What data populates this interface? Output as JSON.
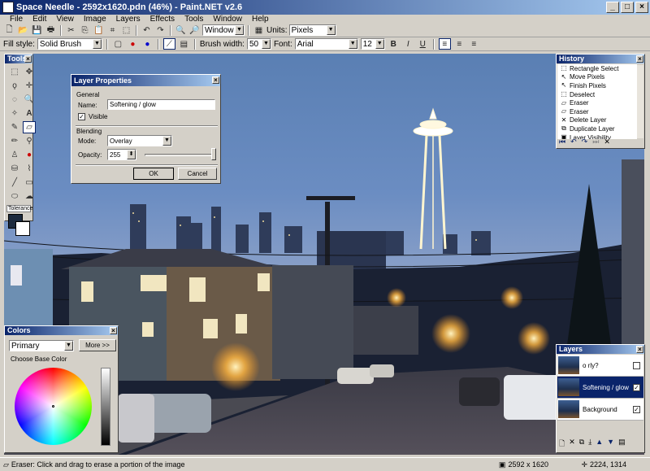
{
  "window": {
    "title": "Space Needle - 2592x1620.pdn (46%) - Paint.NET v2.6"
  },
  "menu": [
    "File",
    "Edit",
    "View",
    "Image",
    "Layers",
    "Effects",
    "Tools",
    "Window",
    "Help"
  ],
  "toolbar1": {
    "zoom_value": "Window",
    "units_label": "Units:",
    "units_value": "Pixels"
  },
  "toolbar2": {
    "fill_style_label": "Fill style:",
    "fill_style_value": "Solid Brush",
    "brush_width_label": "Brush width:",
    "brush_width_value": "50",
    "font_label": "Font:",
    "font_value": "Arial",
    "font_size": "12",
    "bold": "B",
    "italic": "I",
    "underline": "U"
  },
  "tools_panel": {
    "title": "Tools",
    "tolerance_label": "Tolerance"
  },
  "layer_dialog": {
    "title": "Layer Properties",
    "general_label": "General",
    "name_label": "Name:",
    "name_value": "Softening / glow",
    "visible_label": "Visible",
    "blending_label": "Blending",
    "mode_label": "Mode:",
    "mode_value": "Overlay",
    "opacity_label": "Opacity:",
    "opacity_value": "255",
    "ok_label": "OK",
    "cancel_label": "Cancel"
  },
  "history": {
    "title": "History",
    "items": [
      {
        "icon": "rect-select-icon",
        "label": "Rectangle Select"
      },
      {
        "icon": "move-icon",
        "label": "Move Pixels"
      },
      {
        "icon": "finish-icon",
        "label": "Finish Pixels"
      },
      {
        "icon": "deselect-icon",
        "label": "Deselect"
      },
      {
        "icon": "eraser-icon",
        "label": "Eraser"
      },
      {
        "icon": "eraser-icon",
        "label": "Eraser"
      },
      {
        "icon": "delete-layer-icon",
        "label": "Delete Layer"
      },
      {
        "icon": "duplicate-layer-icon",
        "label": "Duplicate Layer"
      },
      {
        "icon": "layer-visibility-icon",
        "label": "Layer Visibility"
      }
    ]
  },
  "colors": {
    "title": "Colors",
    "primary_value": "Primary",
    "more_label": "More >>",
    "choose_label": "Choose Base Color"
  },
  "layers": {
    "title": "Layers",
    "items": [
      {
        "label": "o rly?",
        "checked": false,
        "selected": false
      },
      {
        "label": "Softening / glow",
        "checked": true,
        "selected": true
      },
      {
        "label": "Background",
        "checked": true,
        "selected": false
      }
    ]
  },
  "status": {
    "message": "Eraser: Click and drag to erase a portion of the image",
    "size": "2592 x 1620",
    "coords": "2224, 1314"
  },
  "colors_palette": {
    "accent": "#0a246a",
    "chrome": "#d4d0c8"
  }
}
